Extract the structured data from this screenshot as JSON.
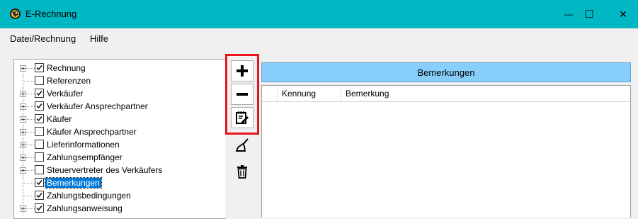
{
  "window": {
    "title": "E-Rechnung",
    "controls": {
      "minimize": "—",
      "maximize": "☐",
      "close": "✕"
    }
  },
  "menu": {
    "items": [
      "Datei/Rechnung",
      "Hilfe"
    ]
  },
  "tree": {
    "items": [
      {
        "label": "Rechnung",
        "checked": true,
        "expandable": true,
        "selected": false
      },
      {
        "label": "Referenzen",
        "checked": false,
        "expandable": false,
        "selected": false
      },
      {
        "label": "Verkäufer",
        "checked": true,
        "expandable": true,
        "selected": false
      },
      {
        "label": "Verkäufer Ansprechpartner",
        "checked": true,
        "expandable": true,
        "selected": false
      },
      {
        "label": "Käufer",
        "checked": true,
        "expandable": true,
        "selected": false
      },
      {
        "label": "Käufer Ansprechpartner",
        "checked": false,
        "expandable": true,
        "selected": false
      },
      {
        "label": "Lieferinformationen",
        "checked": false,
        "expandable": true,
        "selected": false
      },
      {
        "label": "Zahlungsempfänger",
        "checked": false,
        "expandable": true,
        "selected": false
      },
      {
        "label": "Steuervertreter des Verkäufers",
        "checked": false,
        "expandable": true,
        "selected": false
      },
      {
        "label": "Bemerkungen",
        "checked": true,
        "expandable": false,
        "selected": true
      },
      {
        "label": "Zahlungsbedingungen",
        "checked": true,
        "expandable": false,
        "selected": false
      },
      {
        "label": "Zahlungsanweisung",
        "checked": true,
        "expandable": true,
        "selected": false
      }
    ]
  },
  "toolbar": {
    "buttons": [
      {
        "icon": "plus-icon"
      },
      {
        "icon": "minus-icon"
      },
      {
        "icon": "edit-notepad-icon"
      },
      {
        "icon": "broom-icon"
      },
      {
        "icon": "trash-icon"
      }
    ],
    "highlight_color": "#e8141e"
  },
  "section": {
    "title": "Bemerkungen",
    "header_color": "#87cefa"
  },
  "grid": {
    "columns": [
      "Kennung",
      "Bemerkung"
    ],
    "rows": []
  },
  "colors": {
    "titlebar": "#00b7c3",
    "selection": "#0078d7"
  }
}
